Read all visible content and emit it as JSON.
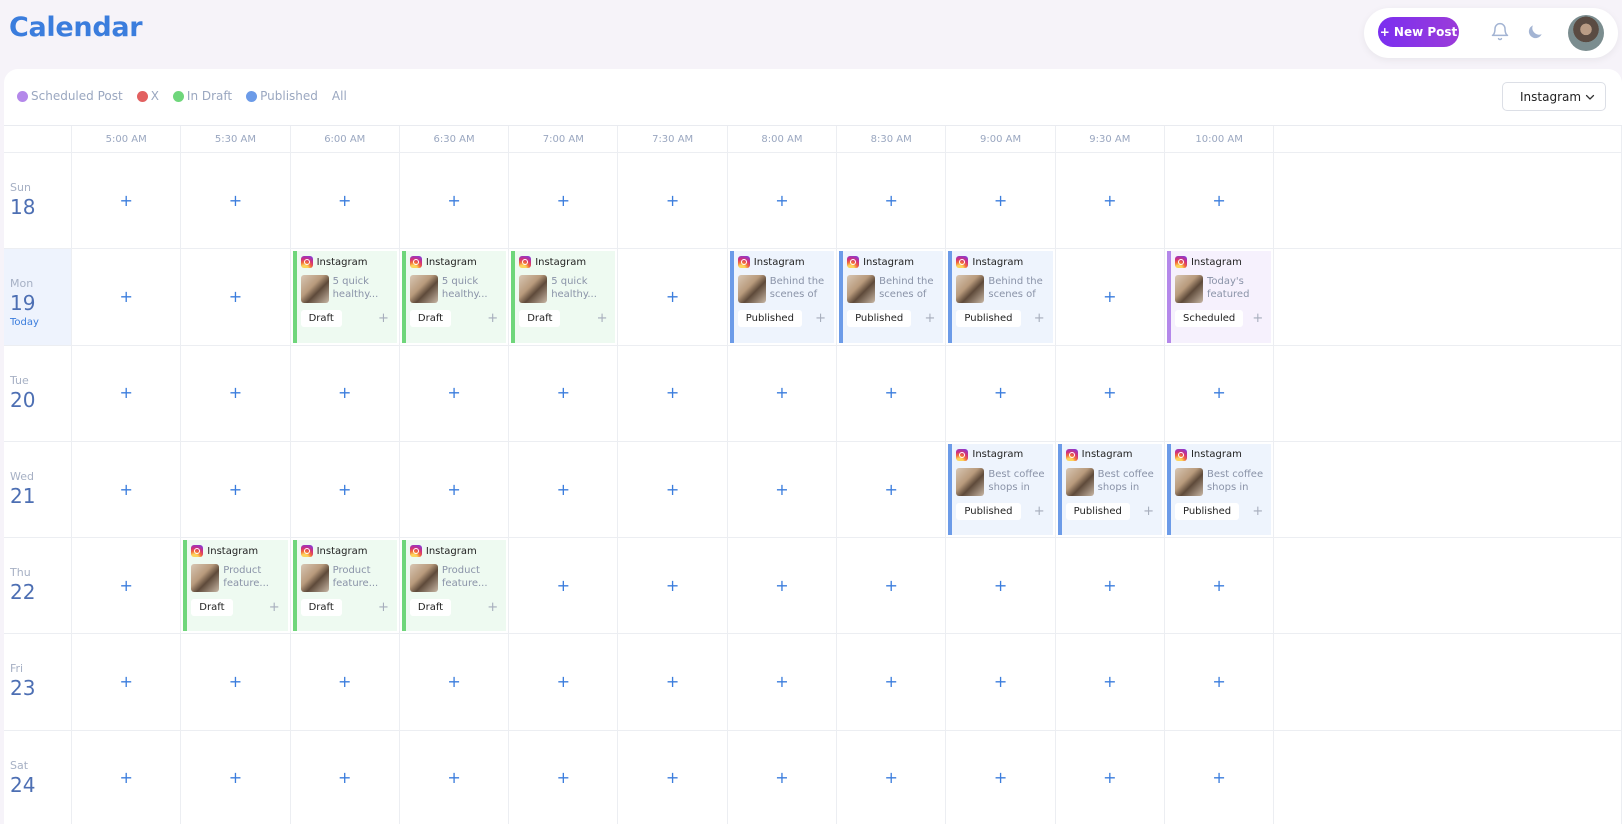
{
  "page": {
    "title": "Calendar"
  },
  "topbar": {
    "new_post_label": "+ New Post",
    "icons": [
      "bell-icon",
      "moon-icon",
      "avatar"
    ]
  },
  "legend": [
    {
      "label": "Scheduled Post",
      "color": "#b488ea",
      "name": "legend-scheduled-post"
    },
    {
      "label": "X",
      "color": "#e26060",
      "name": "legend-x"
    },
    {
      "label": "In Draft",
      "color": "#6fd67b",
      "name": "legend-in-draft"
    },
    {
      "label": "Published",
      "color": "#6c9be8",
      "name": "legend-published"
    },
    {
      "label": "All",
      "color": null,
      "name": "legend-all"
    }
  ],
  "platform_select": {
    "value": "Instagram"
  },
  "times": [
    "5:00 AM",
    "5:30 AM",
    "6:00 AM",
    "6:30 AM",
    "7:00 AM",
    "7:30 AM",
    "8:00 AM",
    "8:30 AM",
    "9:00 AM",
    "9:30 AM",
    "10:00 AM"
  ],
  "days": [
    {
      "name": "Sun",
      "num": "18",
      "today": false
    },
    {
      "name": "Mon",
      "num": "19",
      "today": true,
      "today_label": "Today"
    },
    {
      "name": "Tue",
      "num": "20",
      "today": false
    },
    {
      "name": "Wed",
      "num": "21",
      "today": false
    },
    {
      "name": "Thu",
      "num": "22",
      "today": false
    },
    {
      "name": "Fri",
      "num": "23",
      "today": false
    },
    {
      "name": "Sat",
      "num": "24",
      "today": false
    }
  ],
  "posts": [
    {
      "day": 1,
      "slot": 2,
      "platform": "Instagram",
      "text": "5 quick healthy...",
      "status": "Draft",
      "type": "draft"
    },
    {
      "day": 1,
      "slot": 3,
      "platform": "Instagram",
      "text": "5 quick healthy...",
      "status": "Draft",
      "type": "draft"
    },
    {
      "day": 1,
      "slot": 4,
      "platform": "Instagram",
      "text": "5 quick healthy...",
      "status": "Draft",
      "type": "draft"
    },
    {
      "day": 1,
      "slot": 6,
      "platform": "Instagram",
      "text": "Behind the scenes of ou...",
      "status": "Published",
      "type": "published"
    },
    {
      "day": 1,
      "slot": 7,
      "platform": "Instagram",
      "text": "Behind the scenes of ou...",
      "status": "Published",
      "type": "published"
    },
    {
      "day": 1,
      "slot": 8,
      "platform": "Instagram",
      "text": "Behind the scenes of ou...",
      "status": "Published",
      "type": "published"
    },
    {
      "day": 1,
      "slot": 10,
      "platform": "Instagram",
      "text": "Today's featured stor...",
      "status": "Scheduled",
      "type": "scheduled"
    },
    {
      "day": 3,
      "slot": 8,
      "platform": "Instagram",
      "text": "Best coffee shops in the...",
      "status": "Published",
      "type": "published"
    },
    {
      "day": 3,
      "slot": 9,
      "platform": "Instagram",
      "text": "Best coffee shops in the...",
      "status": "Published",
      "type": "published"
    },
    {
      "day": 3,
      "slot": 10,
      "platform": "Instagram",
      "text": "Best coffee shops in the...",
      "status": "Published",
      "type": "published"
    },
    {
      "day": 4,
      "slot": 1,
      "platform": "Instagram",
      "text": "Product feature...",
      "status": "Draft",
      "type": "draft"
    },
    {
      "day": 4,
      "slot": 2,
      "platform": "Instagram",
      "text": "Product feature...",
      "status": "Draft",
      "type": "draft"
    },
    {
      "day": 4,
      "slot": 3,
      "platform": "Instagram",
      "text": "Product feature...",
      "status": "Draft",
      "type": "draft"
    }
  ],
  "add_slot_label": "+",
  "card_plus_label": "+"
}
